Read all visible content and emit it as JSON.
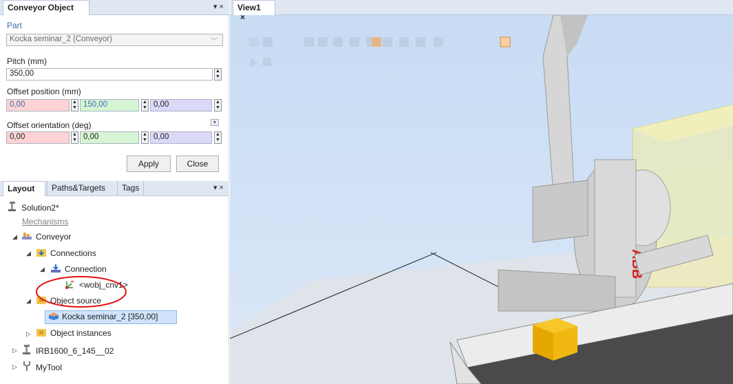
{
  "conveyor_panel": {
    "title": "Conveyor Object",
    "controls": "▾ ×",
    "part_label": "Part",
    "part_value": "Kocka seminar_2 (Conveyor)",
    "pitch_label": "Pitch (mm)",
    "pitch_value": "350,00",
    "offset_pos_label": "Offset position (mm)",
    "offset_pos": [
      "0,00",
      "150,00",
      "0,00"
    ],
    "offset_orient_label": "Offset orientation (deg)",
    "offset_orient": [
      "0,00",
      "0,00",
      "0,00"
    ],
    "apply_label": "Apply",
    "close_label": "Close"
  },
  "layout_panel": {
    "tabs": [
      "Layout",
      "Paths&Targets",
      "Tags"
    ],
    "controls": "▾ ×",
    "tree": {
      "solution": "Solution2*",
      "mechanisms": "Mechanisms",
      "conveyor": "Conveyor",
      "connections": "Connections",
      "connection": "Connection",
      "wobj": "<wobj_cnv1>",
      "object_source": "Object source",
      "source_item": "Kocka seminar_2 [350,00]",
      "object_instances": "Object instances",
      "robot": "IRB1600_6_145__02",
      "tool": "MyTool"
    }
  },
  "view": {
    "tab_label": "View1",
    "tab_close": "×",
    "logo_text": "ABB"
  },
  "colors": {
    "x_field": "#ffd3d3",
    "y_field": "#d6f5d3",
    "z_field": "#dcd8f7",
    "highlight_circle": "#e01010",
    "selected_row": "#cfe3fb"
  }
}
